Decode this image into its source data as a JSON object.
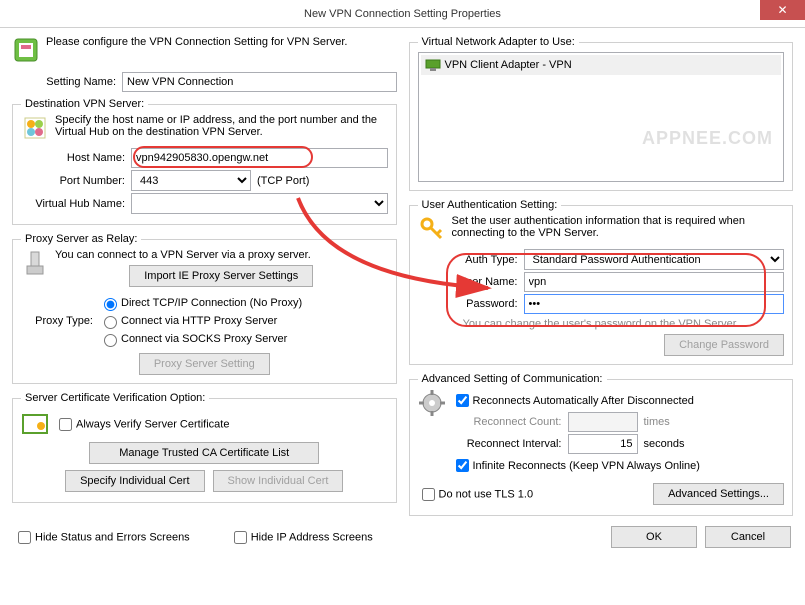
{
  "window": {
    "title": "New VPN Connection Setting Properties"
  },
  "intro": "Please configure the VPN Connection Setting for VPN Server.",
  "setting_name": {
    "label": "Setting Name:",
    "value": "New VPN Connection"
  },
  "dest": {
    "legend": "Destination VPN Server:",
    "desc": "Specify the host name or IP address, and the port number and the Virtual Hub on the destination VPN Server.",
    "host_label": "Host Name:",
    "host_value": "vpn942905830.opengw.net",
    "port_label": "Port Number:",
    "port_value": "443",
    "port_hint": "(TCP Port)",
    "hub_label": "Virtual Hub Name:",
    "hub_value": ""
  },
  "proxy": {
    "legend": "Proxy Server as Relay:",
    "desc": "You can connect to a VPN Server via a proxy server.",
    "import_btn": "Import IE Proxy Server Settings",
    "type_label": "Proxy Type:",
    "opts": [
      "Direct TCP/IP Connection (No Proxy)",
      "Connect via HTTP Proxy Server",
      "Connect via SOCKS Proxy Server"
    ],
    "setting_btn": "Proxy Server Setting"
  },
  "cert": {
    "legend": "Server Certificate Verification Option:",
    "always": "Always Verify Server Certificate",
    "manage_btn": "Manage Trusted CA Certificate List",
    "specify_btn": "Specify Individual Cert",
    "show_btn": "Show Individual Cert"
  },
  "adapter": {
    "legend": "Virtual Network Adapter to Use:",
    "item": "VPN Client Adapter - VPN"
  },
  "auth": {
    "legend": "User Authentication Setting:",
    "desc": "Set the user authentication information that is required when connecting to the VPN Server.",
    "type_label": "Auth Type:",
    "type_value": "Standard Password Authentication",
    "user_label": "User Name:",
    "user_value": "vpn",
    "pass_label": "Password:",
    "pass_value": "•••",
    "hint": "You can change the user's password on the VPN Server.",
    "change_btn": "Change Password"
  },
  "adv": {
    "legend": "Advanced Setting of Communication:",
    "reconnect_auto": "Reconnects Automatically After Disconnected",
    "count_label": "Reconnect Count:",
    "count_value": "",
    "count_unit": "times",
    "interval_label": "Reconnect Interval:",
    "interval_value": "15",
    "interval_unit": "seconds",
    "infinite": "Infinite Reconnects (Keep VPN Always Online)",
    "no_tls": "Do not use TLS 1.0",
    "adv_btn": "Advanced Settings..."
  },
  "bottom": {
    "hide_status": "Hide Status and Errors Screens",
    "hide_ip": "Hide IP Address Screens",
    "ok": "OK",
    "cancel": "Cancel"
  },
  "watermark": "APPNEE.COM"
}
